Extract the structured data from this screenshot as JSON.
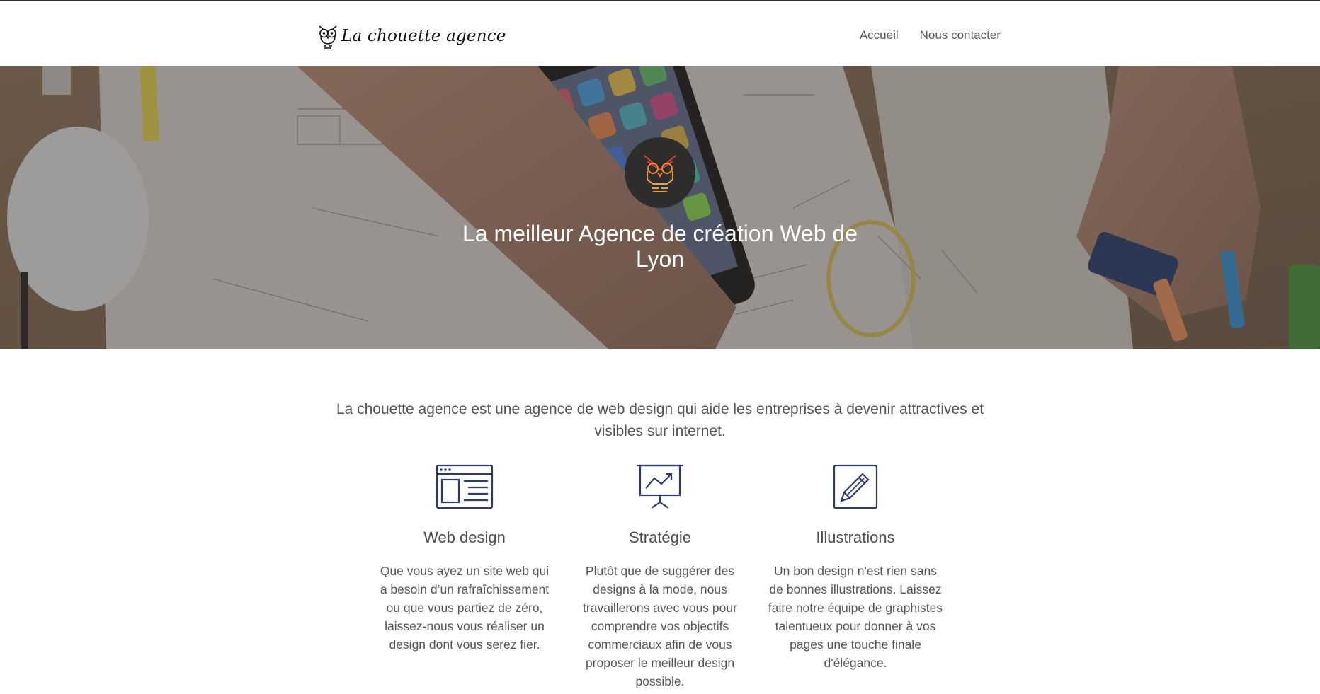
{
  "header": {
    "brand_name": "La chouette agence",
    "nav": [
      {
        "label": "Accueil"
      },
      {
        "label": "Nous contacter"
      }
    ]
  },
  "hero": {
    "title": "La meilleur Agence de création Web de Lyon"
  },
  "intro": {
    "text": "La chouette agence est une agence de web design qui aide les entreprises à devenir attractives et visibles sur internet."
  },
  "services": [
    {
      "icon": "browser-window-icon",
      "title": "Web design",
      "text": "Que vous ayez un site web qui a besoin d’un rafraîchissement ou que vous partiez de zéro, laissez-nous vous réaliser un design dont vous serez fier."
    },
    {
      "icon": "presentation-chart-icon",
      "title": "Stratégie",
      "text": "Plutôt que de suggérer des designs à la mode, nous travaillerons avec vous pour comprendre vos objectifs commerciaux afin de vous proposer le meilleur design possible."
    },
    {
      "icon": "pencil-icon",
      "title": "Illustrations",
      "text": "Un bon design n'est rien sans de bonnes illustrations. Laissez faire notre équipe de graphistes talentueux pour donner à vos pages une touche finale d'élégance."
    }
  ],
  "colors": {
    "icon_navy": "#2f3a6b",
    "text_gray": "#555555",
    "badge_dark": "#2e2d2c",
    "owl_orange": "#e58a3a",
    "owl_red": "#d4403a"
  }
}
